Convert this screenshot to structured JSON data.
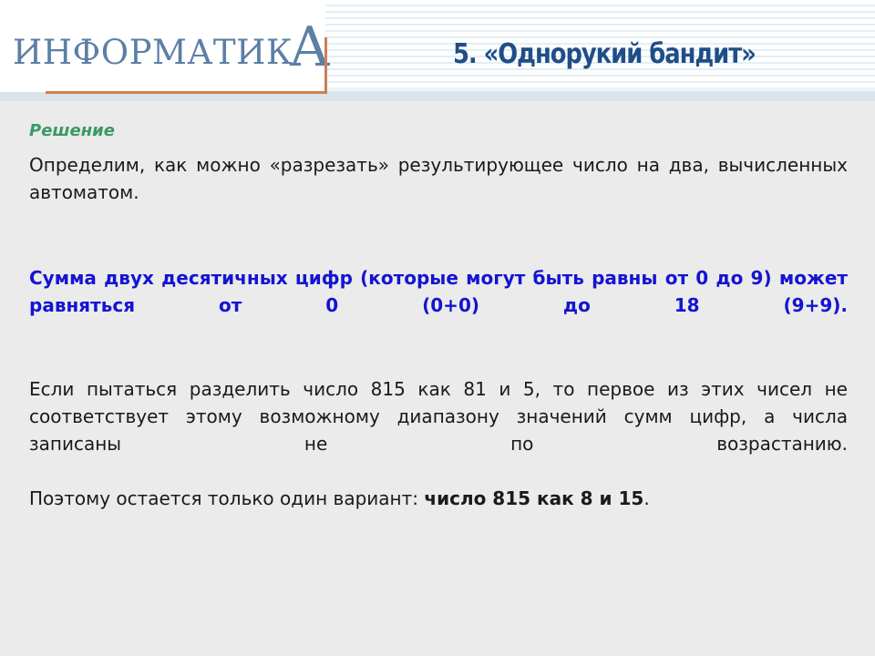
{
  "header": {
    "logo_text_main": "ИНФОРМАТИК",
    "logo_text_accent": "А",
    "title": "5. «Однорукий бандит»",
    "accent_rule_color": "#cd8055",
    "title_color": "#1f4e87",
    "logo_color": "#5b7fa6",
    "stripe_color": "#e3eef5"
  },
  "content": {
    "heading": "Решение",
    "heading_color": "#3a9a63",
    "paragraph_1": "Определим, как можно «разрезать» результирующее число на два, вычисленных автоматом.",
    "paragraph_2_highlight": "Сумма двух десятичных цифр (которые могут быть равны от 0 до 9) может равняться от 0 (0+0) до 18 (9+9).",
    "paragraph_2_color": "#1414d2",
    "paragraph_3": "Если пытаться разделить число 815 как 81 и 5, то первое из этих чисел не соответствует этому возможному диапазону значений сумм цифр, а числа записаны не по возрастанию.",
    "paragraph_4_prefix": "Поэтому остается только один вариант: ",
    "paragraph_4_bold": "число 815 как 8 и 15",
    "paragraph_4_suffix": "."
  },
  "background": {
    "body_color": "#ebebeb",
    "header_color": "#ffffff",
    "header_band_color": "#dbe4ea"
  }
}
